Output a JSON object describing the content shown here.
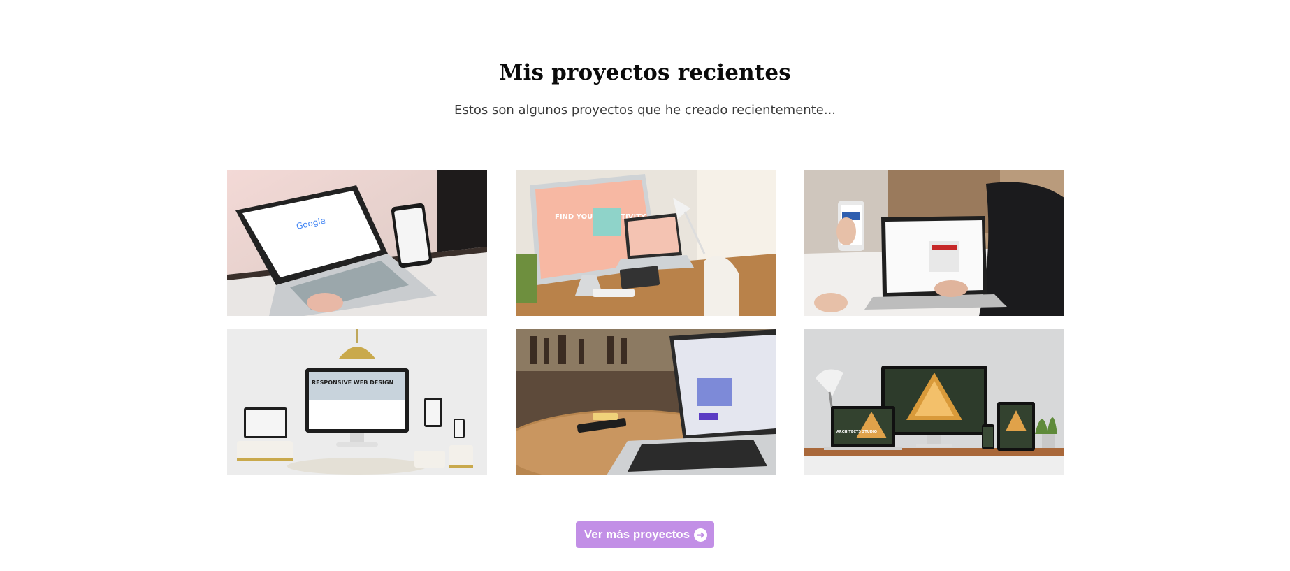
{
  "section": {
    "title": "Mis proyectos recientes",
    "subtitle": "Estos son algunos proyectos que he creado recientemente..."
  },
  "projects": [
    {
      "image": "laptop-phone-google-search",
      "screen_text": "Google"
    },
    {
      "image": "desktop-responsive-creativity",
      "screen_text": "FIND YOUR CREATIVITY"
    },
    {
      "image": "phone-laptop-hands"
    },
    {
      "image": "responsive-web-design-devices",
      "screen_text": "RESPONSIVE WEB DESIGN"
    },
    {
      "image": "laptop-cafe-table"
    },
    {
      "image": "architecture-studio-devices",
      "screen_text": "ARCHITECTS STUDIO"
    }
  ],
  "cta": {
    "label": "Ver más proyectos",
    "icon": "arrow-right-circle-icon"
  },
  "colors": {
    "accent": "#c28fe6",
    "title": "#0b0b0b",
    "subtitle": "#3a3a3a",
    "background": "#ffffff"
  }
}
